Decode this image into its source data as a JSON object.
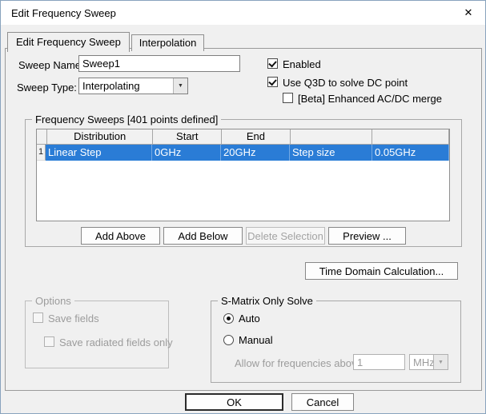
{
  "window": {
    "title": "Edit Frequency Sweep",
    "close_glyph": "✕"
  },
  "tabs": [
    {
      "label": "Edit Frequency Sweep",
      "active": true
    },
    {
      "label": "Interpolation",
      "active": false
    }
  ],
  "form": {
    "sweep_name": {
      "label": "Sweep Name:",
      "value": "Sweep1"
    },
    "sweep_type": {
      "label": "Sweep Type:",
      "value": "Interpolating"
    },
    "enabled": {
      "label": "Enabled",
      "checked": true
    },
    "use_q3d": {
      "label": "Use Q3D to solve DC point",
      "checked": true
    },
    "beta_merge": {
      "label": "[Beta] Enhanced AC/DC merge",
      "checked": false
    }
  },
  "frequency_sweeps": {
    "group_title": "Frequency Sweeps [401 points defined]",
    "table": {
      "headers": [
        "Distribution",
        "Start",
        "End",
        "",
        ""
      ],
      "rows": [
        {
          "num": "1",
          "distribution": "Linear Step",
          "start": "0GHz",
          "end": "20GHz",
          "col4": "Step size",
          "col5": "0.05GHz",
          "selected": true
        }
      ]
    },
    "buttons": {
      "add_above": "Add Above",
      "add_below": "Add Below",
      "delete_selection": "Delete Selection",
      "preview": "Preview ..."
    }
  },
  "time_domain_button": "Time Domain Calculation...",
  "options": {
    "group_title": "Options",
    "save_fields": {
      "label": "Save fields",
      "checked": false,
      "disabled": true
    },
    "save_radiated": {
      "label": "Save radiated fields only",
      "checked": false,
      "disabled": true
    }
  },
  "s_matrix": {
    "group_title": "S-Matrix Only Solve",
    "auto": {
      "label": "Auto",
      "selected": true
    },
    "manual": {
      "label": "Manual",
      "selected": false
    },
    "allow_label": "Allow for frequencies above",
    "frequency_value": "1",
    "unit": "MHz",
    "dropdown_arrow_glyph": "▼"
  },
  "footer": {
    "ok": "OK",
    "cancel": "Cancel"
  },
  "colors": {
    "selection_blue": "#2a7cd6",
    "dialog_bg": "#f0f0f0",
    "titlebar_bg": "#ffffff"
  }
}
